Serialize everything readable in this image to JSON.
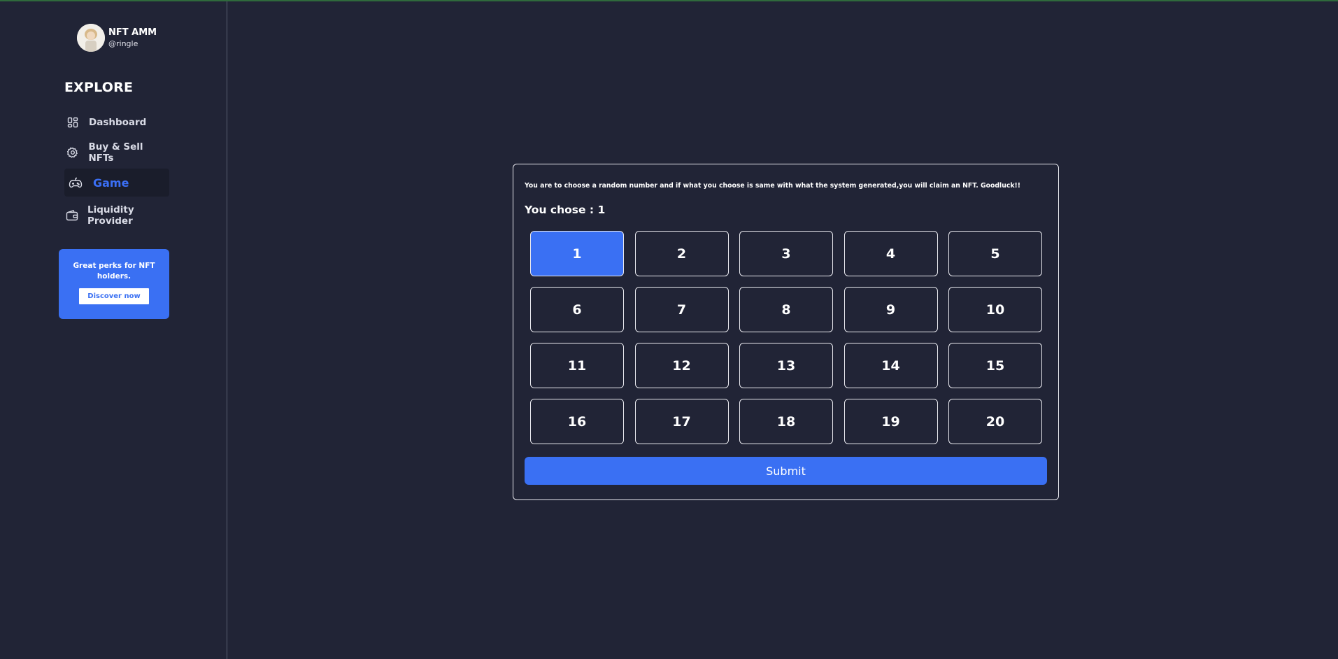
{
  "sidebar": {
    "profile": {
      "name": "NFT AMM",
      "handle": "@ringle"
    },
    "heading": "EXPLORE",
    "items": [
      {
        "label": "Dashboard",
        "icon": "dashboard-icon"
      },
      {
        "label": "Buy & Sell NFTs",
        "icon": "settings-icon"
      },
      {
        "label": "Game",
        "icon": "gamepad-icon",
        "active": true
      },
      {
        "label": "Liquidity Provider",
        "icon": "wallet-icon"
      }
    ],
    "promo": {
      "text": "Great perks for NFT holders.",
      "button": "Discover now"
    }
  },
  "game": {
    "instructions": "You are to choose a random number and if what you choose is same with what the system generated,you will claim an NFT. Goodluck!!",
    "chose_label": "You chose : 1",
    "selected": "1",
    "numbers": [
      "1",
      "2",
      "3",
      "4",
      "5",
      "6",
      "7",
      "8",
      "9",
      "10",
      "11",
      "12",
      "13",
      "14",
      "15",
      "16",
      "17",
      "18",
      "19",
      "20"
    ],
    "submit_label": "Submit"
  },
  "colors": {
    "background": "#212436",
    "accent": "#3a70f3",
    "border": "#e9e9ef"
  }
}
